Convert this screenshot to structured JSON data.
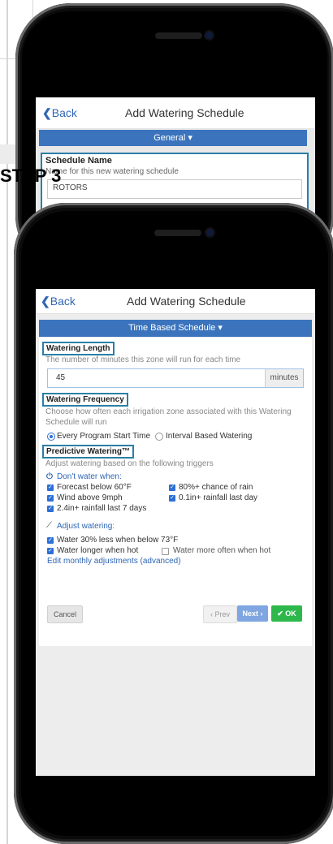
{
  "top_screen": {
    "nav": {
      "back_label": "Back",
      "title": "Add Watering Schedule"
    },
    "section_dropdown": "General ▾",
    "schedule_name": {
      "label": "Schedule Name",
      "hint": "Name for this new watering schedule",
      "value": "ROTORS"
    }
  },
  "overlay_label": "STEP 3",
  "main_screen": {
    "nav": {
      "back_label": "Back",
      "title": "Add Watering Schedule"
    },
    "section_dropdown": "Time Based Schedule ▾",
    "watering_length": {
      "label": "Watering Length",
      "hint": "The number of minutes this zone will run for each time",
      "value": "45",
      "unit": "minutes"
    },
    "watering_frequency": {
      "label": "Watering Frequency",
      "hint": "Choose how often each irrigation zone associated with this Watering Schedule will run",
      "options": [
        {
          "label": "Every Program Start Time",
          "selected": true
        },
        {
          "label": "Interval Based Watering",
          "selected": false
        }
      ]
    },
    "predictive_watering": {
      "label": "Predictive Watering™",
      "hint": "Adjust watering based on the following triggers",
      "dont_water_header": "Don't water when:",
      "dont_water_items": [
        {
          "label": "Forecast below 60°F",
          "checked": true
        },
        {
          "label": "80%+ chance of rain",
          "checked": true
        },
        {
          "label": "Wind above 9mph",
          "checked": true
        },
        {
          "label": "0.1in+ rainfall last day",
          "checked": true
        },
        {
          "label": "2.4in+ rainfall last 7 days",
          "checked": true
        }
      ],
      "adjust_header": "Adjust watering:",
      "adjust_items": [
        {
          "label": "Water 30% less when below 73°F",
          "checked": true
        },
        {
          "label": "Water longer when hot",
          "checked": true
        },
        {
          "label": "Water more often when hot",
          "checked": false
        }
      ],
      "advanced_link": "Edit monthly adjustments (advanced)"
    },
    "footer": {
      "cancel_label": "Cancel",
      "prev_label": "‹ Prev",
      "next_label": "Next ›",
      "ok_label": "✔ OK"
    }
  },
  "colors": {
    "accent": "#3b74bd",
    "highlight_border": "#2b7fa6",
    "ok_green": "#2eb84b",
    "next_blue": "#7fa6e0"
  }
}
